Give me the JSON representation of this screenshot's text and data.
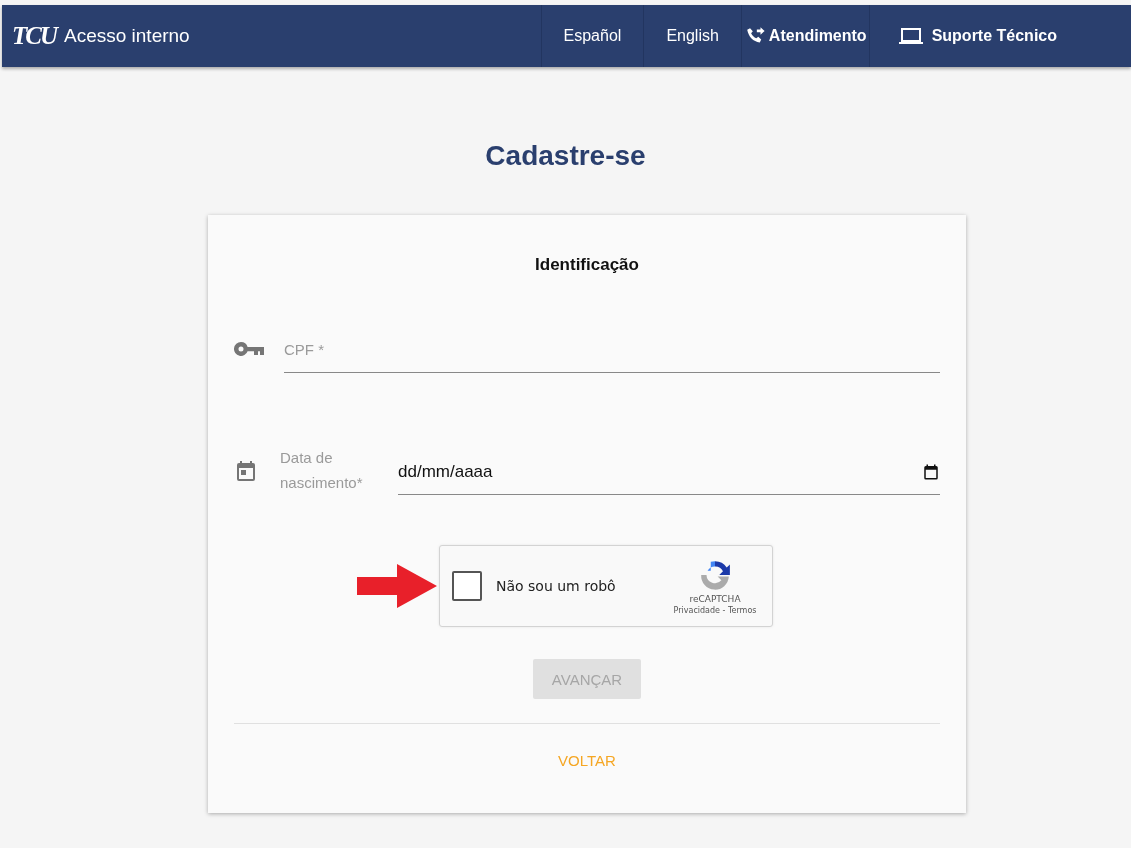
{
  "header": {
    "logo": "TCU",
    "title": "Acesso interno",
    "nav": [
      {
        "label": "Español",
        "kind": "text"
      },
      {
        "label": "English",
        "kind": "text"
      },
      {
        "label": "Atendimento",
        "kind": "phone"
      },
      {
        "label": "Suporte Técnico",
        "kind": "laptop"
      }
    ]
  },
  "page_title": "Cadastre-se",
  "card": {
    "section_title": "Identificação",
    "cpf": {
      "placeholder": "CPF *"
    },
    "birth_date": {
      "label": "Data de nascimento*",
      "placeholder": "dd/mm/aaaa"
    },
    "captcha": {
      "checked": false,
      "label": "Não sou um robô",
      "brand": "reCAPTCHA",
      "privacy": "Privacidade",
      "separator": " - ",
      "terms": "Termos"
    },
    "next_button": {
      "label": "AVANÇAR",
      "disabled": true
    },
    "back_link": "VOLTAR"
  }
}
